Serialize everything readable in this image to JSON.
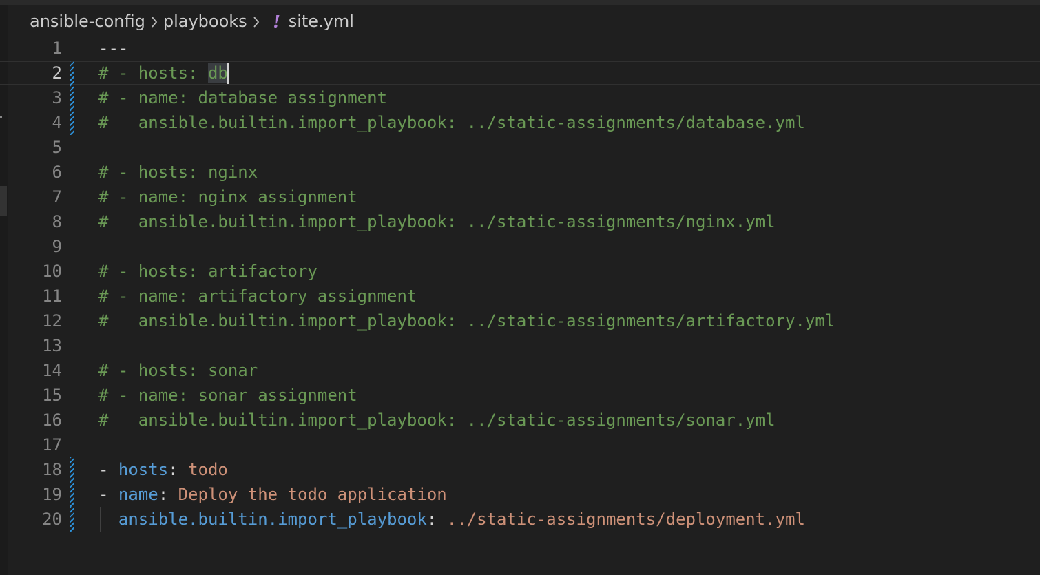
{
  "breadcrumb": {
    "items": [
      "ansible-config",
      "playbooks"
    ],
    "file_icon": "!",
    "file_name": "site.yml"
  },
  "editor": {
    "current_line": 2,
    "lines": [
      {
        "num": "1",
        "tokens": [
          {
            "t": "---",
            "k": "punc"
          }
        ]
      },
      {
        "num": "2",
        "tokens": [
          {
            "t": "# - hosts: ",
            "k": "comment"
          },
          {
            "t": "db",
            "k": "comment-hl"
          }
        ]
      },
      {
        "num": "3",
        "tokens": [
          {
            "t": "# - name: database assignment",
            "k": "comment"
          }
        ]
      },
      {
        "num": "4",
        "tokens": [
          {
            "t": "#   ansible.builtin.import_playbook: ../static-assignments/database.yml",
            "k": "comment"
          }
        ]
      },
      {
        "num": "5",
        "tokens": []
      },
      {
        "num": "6",
        "tokens": [
          {
            "t": "# - hosts: nginx",
            "k": "comment"
          }
        ]
      },
      {
        "num": "7",
        "tokens": [
          {
            "t": "# - name: nginx assignment",
            "k": "comment"
          }
        ]
      },
      {
        "num": "8",
        "tokens": [
          {
            "t": "#   ansible.builtin.import_playbook: ../static-assignments/nginx.yml",
            "k": "comment"
          }
        ]
      },
      {
        "num": "9",
        "tokens": []
      },
      {
        "num": "10",
        "tokens": [
          {
            "t": "# - hosts: artifactory",
            "k": "comment"
          }
        ]
      },
      {
        "num": "11",
        "tokens": [
          {
            "t": "# - name: artifactory assignment",
            "k": "comment"
          }
        ]
      },
      {
        "num": "12",
        "tokens": [
          {
            "t": "#   ansible.builtin.import_playbook: ../static-assignments/artifactory.yml",
            "k": "comment"
          }
        ]
      },
      {
        "num": "13",
        "tokens": []
      },
      {
        "num": "14",
        "tokens": [
          {
            "t": "# - hosts: sonar",
            "k": "comment"
          }
        ]
      },
      {
        "num": "15",
        "tokens": [
          {
            "t": "# - name: sonar assignment",
            "k": "comment"
          }
        ]
      },
      {
        "num": "16",
        "tokens": [
          {
            "t": "#   ansible.builtin.import_playbook: ../static-assignments/sonar.yml",
            "k": "comment"
          }
        ]
      },
      {
        "num": "17",
        "tokens": []
      },
      {
        "num": "18",
        "tokens": [
          {
            "t": "- ",
            "k": "punc"
          },
          {
            "t": "hosts",
            "k": "key"
          },
          {
            "t": ": ",
            "k": "punc"
          },
          {
            "t": "todo",
            "k": "str"
          }
        ]
      },
      {
        "num": "19",
        "tokens": [
          {
            "t": "- ",
            "k": "punc"
          },
          {
            "t": "name",
            "k": "key"
          },
          {
            "t": ": ",
            "k": "punc"
          },
          {
            "t": "Deploy the todo application",
            "k": "str"
          }
        ]
      },
      {
        "num": "20",
        "tokens": [
          {
            "t": "  ",
            "k": "punc"
          },
          {
            "t": "ansible.builtin.import_playbook",
            "k": "key"
          },
          {
            "t": ": ",
            "k": "punc"
          },
          {
            "t": "../static-assignments/deployment.yml",
            "k": "str"
          }
        ]
      }
    ],
    "modified_lines": [
      "2",
      "3",
      "4",
      "18",
      "19",
      "20"
    ],
    "indent_guide_lines": [
      "20"
    ]
  },
  "colors": {
    "background": "#1f1f1f",
    "comment": "#6a9955",
    "key": "#569cd6",
    "string": "#ce9178",
    "line_number": "#858585",
    "diff_modified": "#2c8fd6"
  }
}
